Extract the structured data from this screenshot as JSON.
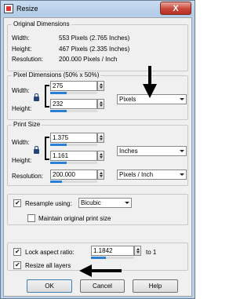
{
  "window": {
    "title": "Resize",
    "close_label": "X"
  },
  "original_dimensions": {
    "label": "Original Dimensions",
    "width_label": "Width:",
    "width_value": "553 Pixels (2.765 Inches)",
    "height_label": "Height:",
    "height_value": "467 Pixels (2.335 Inches)",
    "resolution_label": "Resolution:",
    "resolution_value": "200.000 Pixels / Inch"
  },
  "pixel_dimensions": {
    "label": "Pixel Dimensions (50% x 50%)",
    "width_label": "Width:",
    "width_value": "275",
    "height_label": "Height:",
    "height_value": "232",
    "unit": "Pixels",
    "width_bar_fraction": 0.35,
    "height_bar_fraction": 0.35
  },
  "print_size": {
    "label": "Print Size",
    "width_label": "Width:",
    "width_value": "1.375",
    "height_label": "Height:",
    "height_value": "1.161",
    "unit": "Inches",
    "resolution_label": "Resolution:",
    "resolution_value": "200.000",
    "resolution_unit": "Pixels / Inch",
    "width_bar_fraction": 0.35,
    "height_bar_fraction": 0.35,
    "resolution_bar_fraction": 0.25
  },
  "options": {
    "resample_label": "Resample using:",
    "resample_checked": true,
    "resample_method": "Bicubic",
    "maintain_label": "Maintain original print size",
    "maintain_checked": false,
    "lock_label": "Lock aspect ratio:",
    "lock_checked": true,
    "ratio_value": "1.1842",
    "ratio_suffix": "to 1",
    "ratio_bar_fraction": 0.35,
    "resize_all_label": "Resize all layers",
    "resize_all_checked": true
  },
  "buttons": {
    "ok": "OK",
    "cancel": "Cancel",
    "help": "Help"
  },
  "annotations": {
    "arrow_color": "#000000"
  }
}
